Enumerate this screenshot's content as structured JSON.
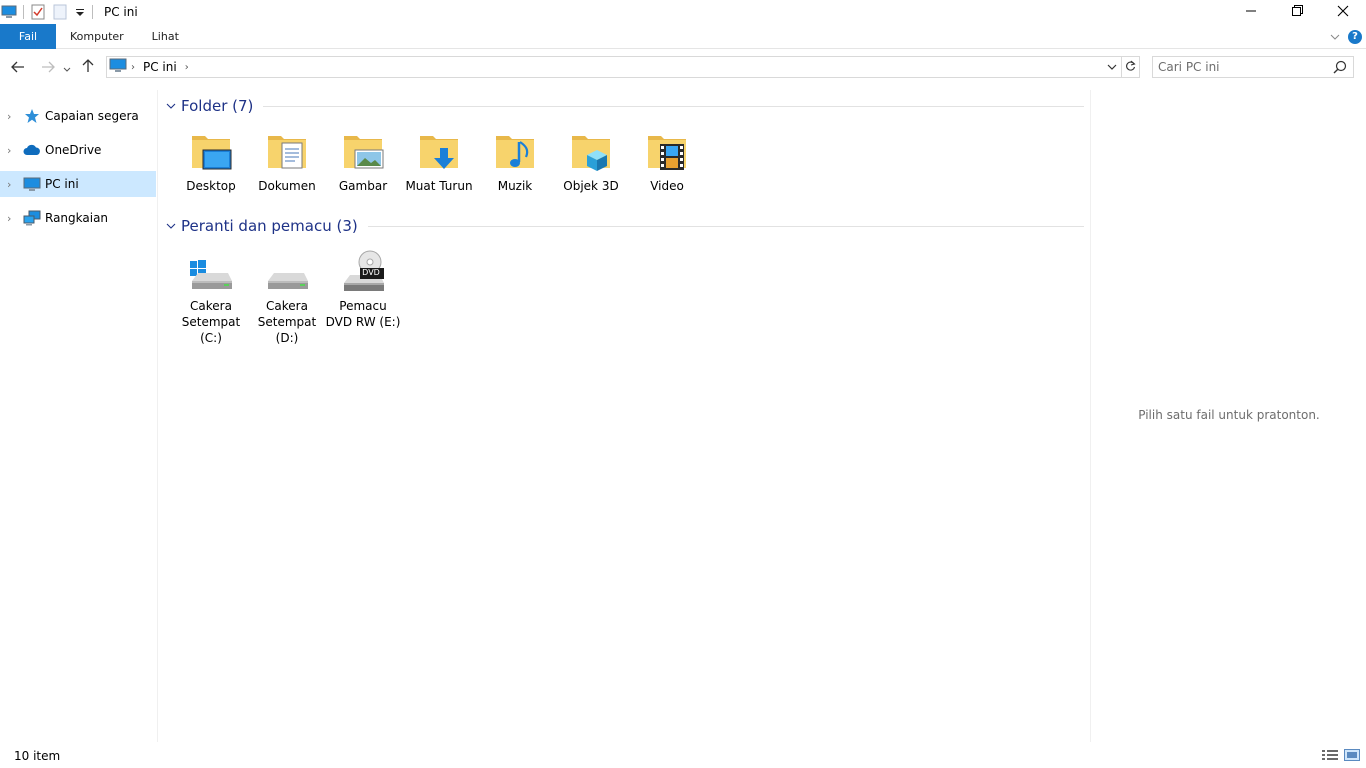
{
  "window": {
    "title": "PC ini",
    "icons": [
      "computer-icon",
      "properties-icon",
      "new-folder-icon",
      "customize-qa-icon"
    ],
    "controls": [
      "minimize",
      "restore",
      "close"
    ]
  },
  "ribbon": {
    "tabs": [
      {
        "label": "Fail",
        "active": true
      },
      {
        "label": "Komputer"
      },
      {
        "label": "Lihat"
      }
    ],
    "accent": "#1979ca",
    "help_label": "?"
  },
  "address": {
    "location": "PC ini",
    "search_placeholder": "Cari PC ini"
  },
  "sidebar": {
    "items": [
      {
        "label": "Capaian segera",
        "icon": "star-icon"
      },
      {
        "label": "OneDrive",
        "icon": "onedrive-cloud-icon"
      },
      {
        "label": "PC ini",
        "icon": "computer-icon",
        "selected": true
      },
      {
        "label": "Rangkaian",
        "icon": "network-icon"
      }
    ],
    "selected_color": "#cce8ff"
  },
  "groups": [
    {
      "title": "Folder (7)",
      "items": [
        {
          "label": "Desktop",
          "icon": "desktop-folder-icon"
        },
        {
          "label": "Dokumen",
          "icon": "documents-folder-icon"
        },
        {
          "label": "Gambar",
          "icon": "pictures-folder-icon"
        },
        {
          "label": "Muat Turun",
          "icon": "downloads-folder-icon"
        },
        {
          "label": "Muzik",
          "icon": "music-folder-icon"
        },
        {
          "label": "Objek 3D",
          "icon": "3d-objects-folder-icon"
        },
        {
          "label": "Video",
          "icon": "videos-folder-icon"
        }
      ]
    },
    {
      "title": "Peranti dan pemacu (3)",
      "items": [
        {
          "label": "Cakera Setempat (C:)",
          "icon": "windows-drive-icon"
        },
        {
          "label": "Cakera Setempat (D:)",
          "icon": "drive-icon"
        },
        {
          "label": "Pemacu DVD RW (E:)",
          "icon": "dvd-drive-icon",
          "badge": "DVD"
        }
      ]
    }
  ],
  "header_color": "#1e3287",
  "preview": {
    "message": "Pilih satu fail untuk pratonton."
  },
  "status": {
    "item_count": "10 item"
  }
}
